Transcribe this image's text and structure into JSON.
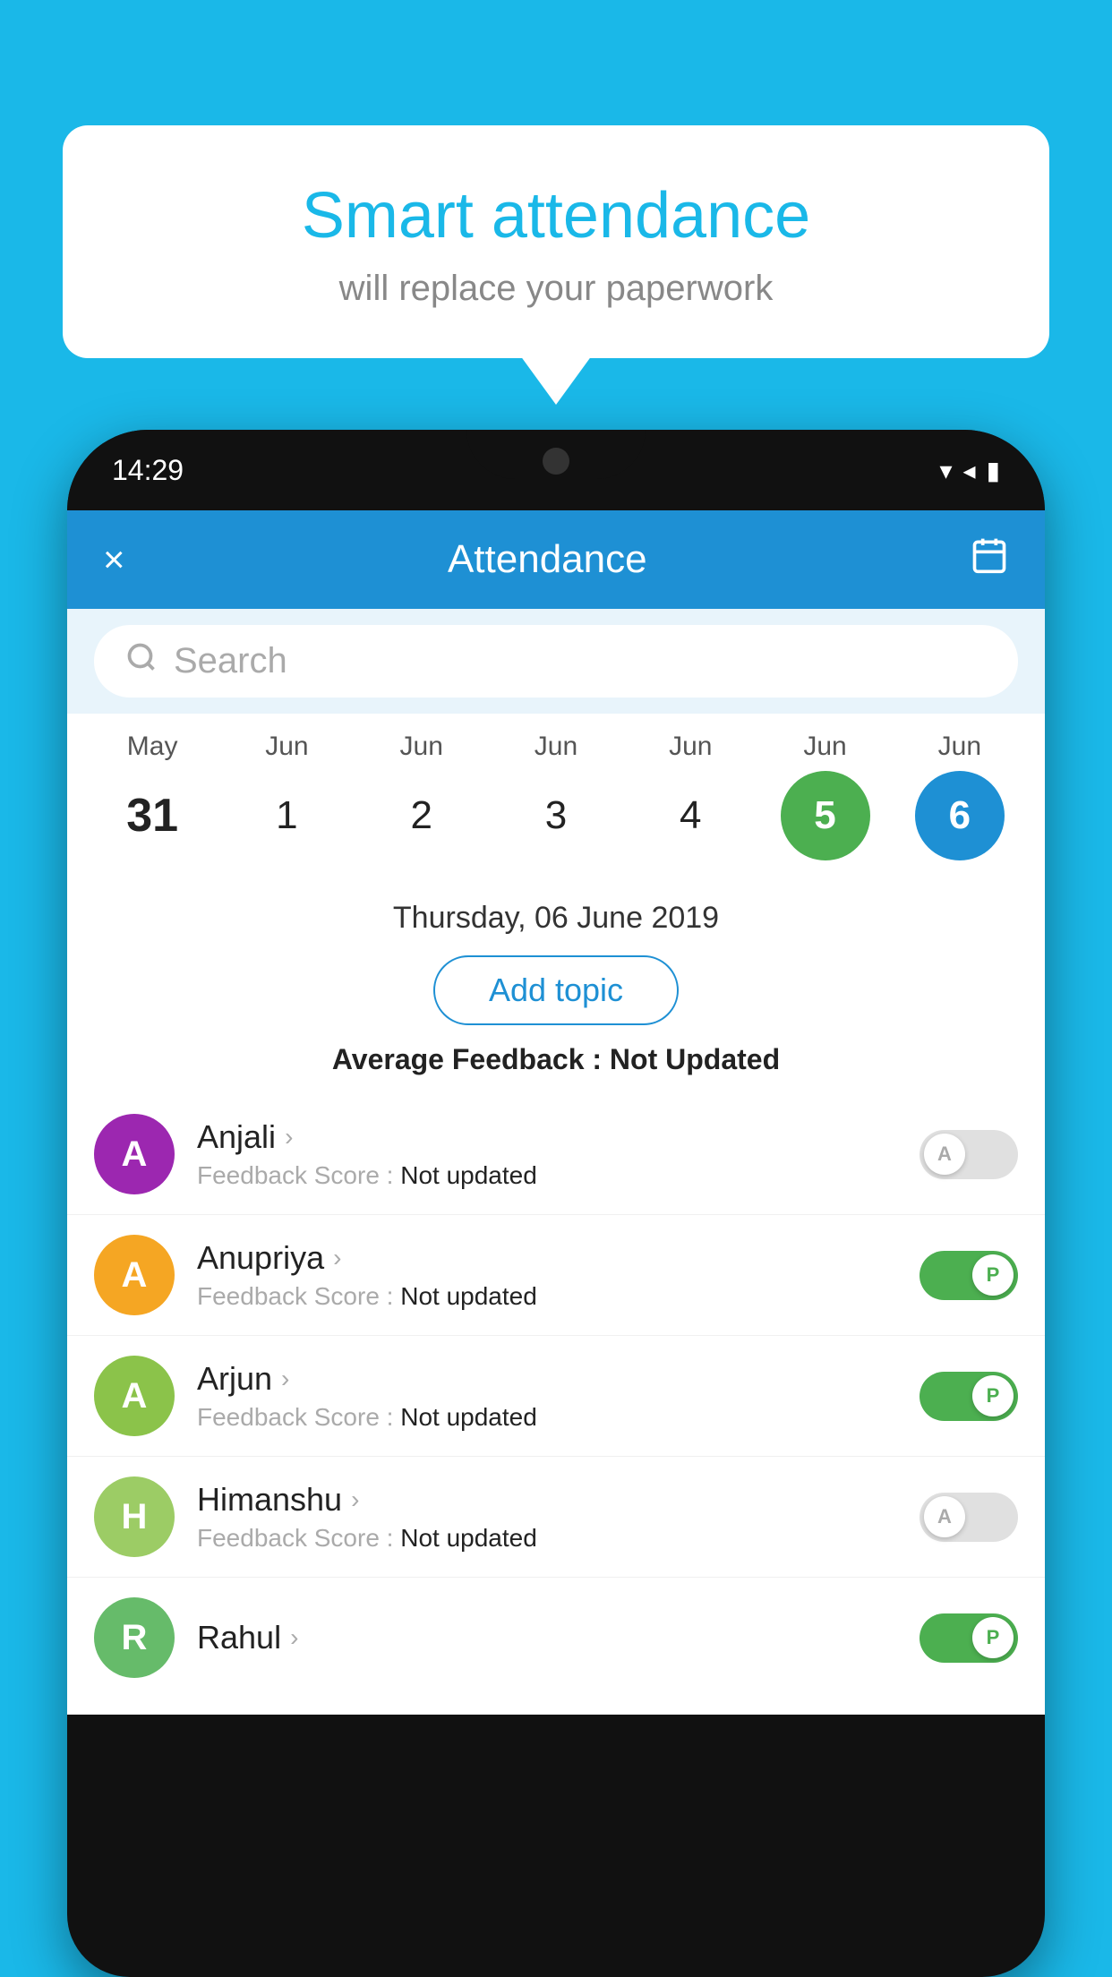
{
  "background_color": "#1ab8e8",
  "speech_bubble": {
    "title": "Smart attendance",
    "subtitle": "will replace your paperwork"
  },
  "phone": {
    "status_bar": {
      "time": "14:29",
      "signal": "▼◀▮"
    },
    "header": {
      "close_label": "×",
      "title": "Attendance",
      "calendar_icon": "📅"
    },
    "search": {
      "placeholder": "Search"
    },
    "calendar": {
      "months": [
        "May",
        "Jun",
        "Jun",
        "Jun",
        "Jun",
        "Jun",
        "Jun"
      ],
      "dates": [
        "31",
        "1",
        "2",
        "3",
        "4",
        "5",
        "6"
      ],
      "selected_green_index": 5,
      "selected_blue_index": 6
    },
    "selected_date": {
      "label": "Thursday, 06 June 2019",
      "add_topic_btn": "Add topic",
      "avg_feedback_label": "Average Feedback : ",
      "avg_feedback_value": "Not Updated"
    },
    "students": [
      {
        "name": "Anjali",
        "avatar_letter": "A",
        "avatar_color": "#9c27b0",
        "score_label": "Feedback Score : ",
        "score_value": "Not updated",
        "toggle_state": "off",
        "toggle_label": "A"
      },
      {
        "name": "Anupriya",
        "avatar_letter": "A",
        "avatar_color": "#f5a623",
        "score_label": "Feedback Score : ",
        "score_value": "Not updated",
        "toggle_state": "on",
        "toggle_label": "P"
      },
      {
        "name": "Arjun",
        "avatar_letter": "A",
        "avatar_color": "#8bc34a",
        "score_label": "Feedback Score : ",
        "score_value": "Not updated",
        "toggle_state": "on",
        "toggle_label": "P"
      },
      {
        "name": "Himanshu",
        "avatar_letter": "H",
        "avatar_color": "#9ccc65",
        "score_label": "Feedback Score : ",
        "score_value": "Not updated",
        "toggle_state": "off",
        "toggle_label": "A"
      }
    ]
  }
}
